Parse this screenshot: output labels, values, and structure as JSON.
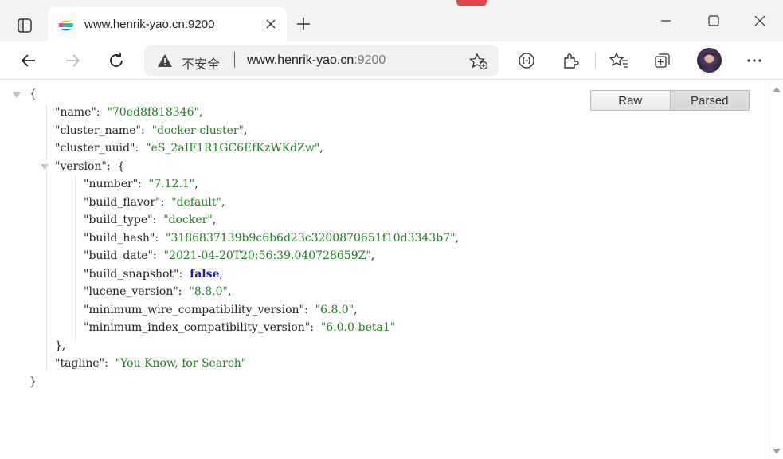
{
  "tab": {
    "title": "www.henrik-yao.cn:9200"
  },
  "address": {
    "insecure_label": "不安全",
    "url_host": "www.henrik-yao.cn",
    "url_port": ":9200"
  },
  "view": {
    "raw_label": "Raw",
    "parsed_label": "Parsed"
  },
  "json": {
    "open_brace": "{",
    "close_brace": "}",
    "name_key": "\"name\"",
    "name_val": "\"70ed8f818346\"",
    "cluster_name_key": "\"cluster_name\"",
    "cluster_name_val": "\"docker-cluster\"",
    "cluster_uuid_key": "\"cluster_uuid\"",
    "cluster_uuid_val": "\"eS_2aIF1R1GC6EfKzWKdZw\"",
    "version_key": "\"version\"",
    "number_key": "\"number\"",
    "number_val": "\"7.12.1\"",
    "build_flavor_key": "\"build_flavor\"",
    "build_flavor_val": "\"default\"",
    "build_type_key": "\"build_type\"",
    "build_type_val": "\"docker\"",
    "build_hash_key": "\"build_hash\"",
    "build_hash_val": "\"3186837139b9c6b6d23c3200870651f10d3343b7\"",
    "build_date_key": "\"build_date\"",
    "build_date_val": "\"2021-04-20T20:56:39.040728659Z\"",
    "build_snapshot_key": "\"build_snapshot\"",
    "build_snapshot_val": "false",
    "lucene_version_key": "\"lucene_version\"",
    "lucene_version_val": "\"8.8.0\"",
    "min_wire_key": "\"minimum_wire_compatibility_version\"",
    "min_wire_val": "\"6.8.0\"",
    "min_index_key": "\"minimum_index_compatibility_version\"",
    "min_index_val": "\"6.0.0-beta1\"",
    "version_close": "},",
    "tagline_key": "\"tagline\"",
    "tagline_val": "\"You Know, for Search\""
  },
  "colors": {
    "string": "#1a7f1a",
    "boolean": "#1a1aa6",
    "accent_close": "#e04848"
  },
  "icons": [
    "sidebar-icon",
    "elastic-favicon",
    "close-icon",
    "plus-icon",
    "minimize-icon",
    "maximize-icon",
    "close-window-icon",
    "back-icon",
    "forward-icon",
    "refresh-icon",
    "warning-icon",
    "favorite-add-icon",
    "reader-icon",
    "extensions-icon",
    "favorites-icon",
    "collections-icon",
    "avatar",
    "more-icon"
  ]
}
